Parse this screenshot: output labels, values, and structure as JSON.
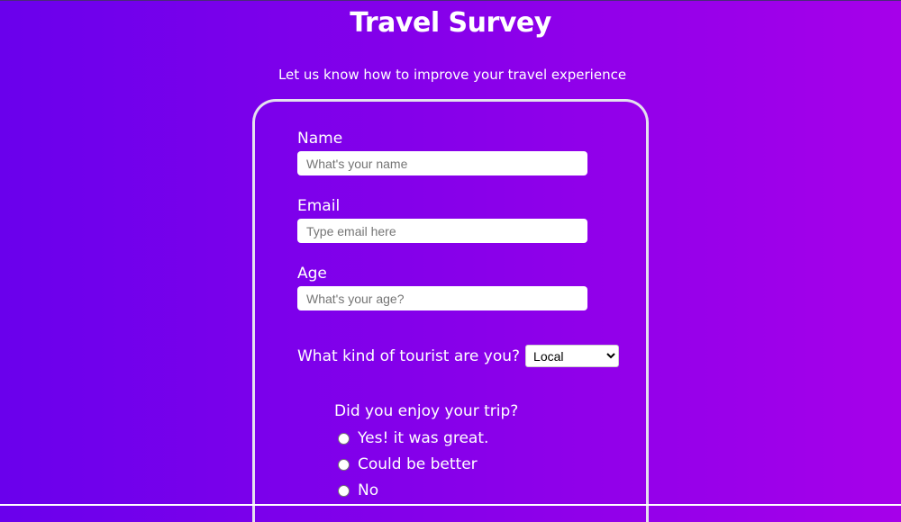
{
  "header": {
    "title": "Travel Survey",
    "subtitle": "Let us know how to improve your travel experience"
  },
  "form": {
    "name": {
      "label": "Name",
      "placeholder": "What's your name",
      "value": ""
    },
    "email": {
      "label": "Email",
      "placeholder": "Type email here",
      "value": ""
    },
    "age": {
      "label": "Age",
      "placeholder": "What's your age?",
      "value": ""
    },
    "tourist": {
      "label": "What kind of tourist are you?",
      "selected": "Local"
    },
    "enjoy": {
      "question": "Did you enjoy your trip?",
      "options": [
        {
          "label": "Yes! it was great.",
          "checked": false
        },
        {
          "label": "Could be better",
          "checked": false
        },
        {
          "label": "No",
          "checked": false
        }
      ]
    }
  },
  "colors": {
    "gradient_start": "#6a00ec",
    "gradient_end": "#a600ea",
    "card_border": "#e4e0ee",
    "text": "#ffffff"
  }
}
